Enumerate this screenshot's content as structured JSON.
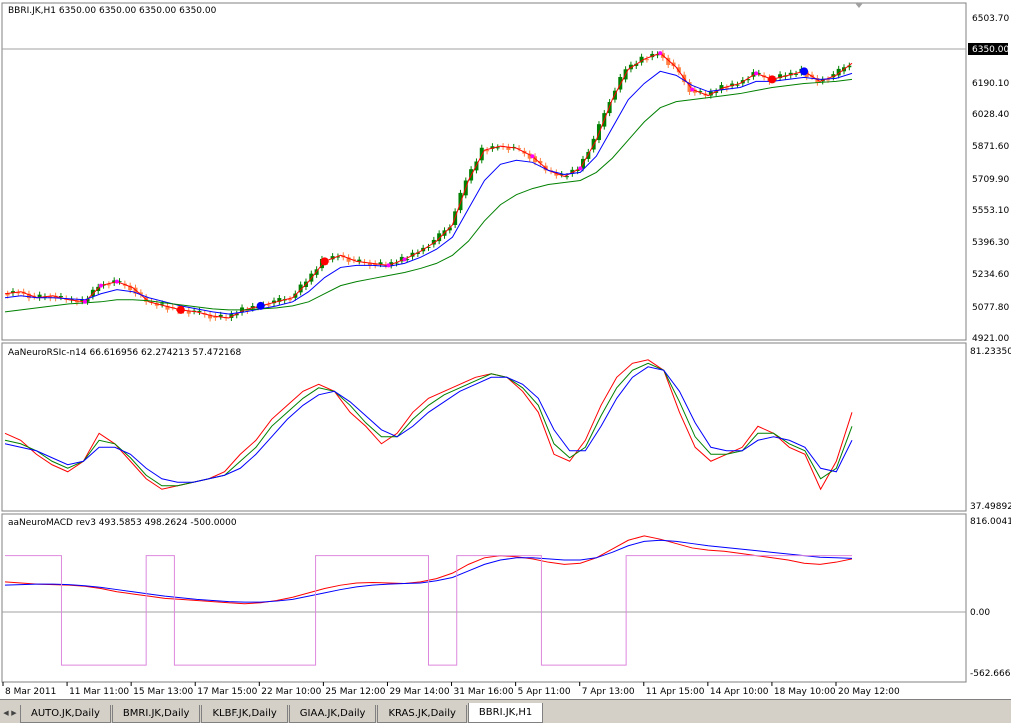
{
  "main_pane": {
    "title": "BBRI.JK,H1  6350.00 6350.00 6350.00 6350.00",
    "price_ticks": [
      "6503.70",
      "6350.00",
      "6190.10",
      "6028.40",
      "5871.60",
      "5709.90",
      "5553.10",
      "5396.30",
      "5234.60",
      "5077.80",
      "4921.00"
    ],
    "current_price_label": "6350.00"
  },
  "rsi_pane": {
    "title": "AaNeuroRSIc-n14 66.616956 62.274213 57.472168",
    "ticks": [
      "81.23350",
      "37.49892"
    ]
  },
  "macd_pane": {
    "title": "aaNeuroMACD rev3 493.5853 498.2624 -500.0000",
    "ticks": [
      "816.0041",
      "0.00",
      "-562.666"
    ]
  },
  "time_axis": {
    "labels": [
      "8 Mar 2011",
      "11 Mar 11:00",
      "15 Mar 13:00",
      "17 Mar 15:00",
      "22 Mar 10:00",
      "25 Mar 12:00",
      "29 Mar 14:00",
      "31 Mar 16:00",
      "5 Apr 11:00",
      "7 Apr 13:00",
      "11 Apr 15:00",
      "14 Apr 10:00",
      "18 May 10:00",
      "20 May 12:00"
    ]
  },
  "tabs": [
    {
      "label": "AUTO.JK,Daily",
      "active": false
    },
    {
      "label": "BMRI.JK,Daily",
      "active": false
    },
    {
      "label": "KLBF.JK,Daily",
      "active": false
    },
    {
      "label": "GIAA.JK,Daily",
      "active": false
    },
    {
      "label": "KRAS.JK,Daily",
      "active": false
    },
    {
      "label": "BBRI.JK,H1",
      "active": true
    }
  ],
  "colors": {
    "bull_candle": "#008000",
    "bear_candle": "#ff8040",
    "ma_fast": "#ff0000",
    "ma_mid": "#0000ff",
    "ma_slow": "#008000",
    "signal_dot": "#ff00ff",
    "rsi_lines": [
      "#ff0000",
      "#008000",
      "#0000ff"
    ],
    "macd_lines": [
      "#ff0000",
      "#0000ff",
      "#dd88dd"
    ]
  },
  "chart_data": [
    {
      "type": "line",
      "description_source": "candlestick price pane with three moving averages",
      "ylim": [
        4921.0,
        6503.7
      ],
      "series": [
        {
          "values": [
            5140,
            5150,
            5120,
            5130,
            5110,
            5100,
            5180,
            5200,
            5170,
            5100,
            5080,
            5060,
            5050,
            5030,
            5020,
            5060,
            5080,
            5100,
            5120,
            5200,
            5300,
            5330,
            5300,
            5290,
            5280,
            5310,
            5350,
            5400,
            5480,
            5700,
            5850,
            5870,
            5860,
            5820,
            5750,
            5720,
            5760,
            5900,
            6100,
            6250,
            6300,
            6330,
            6260,
            6150,
            6120,
            6160,
            6180,
            6230,
            6200,
            6220,
            6240,
            6190,
            6220,
            6280
          ]
        },
        {
          "values": [
            5120,
            5130,
            5120,
            5120,
            5115,
            5110,
            5140,
            5160,
            5150,
            5120,
            5100,
            5080,
            5065,
            5050,
            5040,
            5050,
            5065,
            5080,
            5100,
            5150,
            5220,
            5270,
            5280,
            5280,
            5275,
            5290,
            5320,
            5360,
            5420,
            5560,
            5700,
            5780,
            5800,
            5790,
            5750,
            5730,
            5740,
            5820,
            5960,
            6100,
            6180,
            6240,
            6220,
            6170,
            6140,
            6150,
            6160,
            6190,
            6190,
            6200,
            6210,
            6200,
            6205,
            6230
          ]
        },
        {
          "values": [
            5050,
            5060,
            5070,
            5080,
            5090,
            5095,
            5100,
            5110,
            5110,
            5105,
            5095,
            5085,
            5075,
            5065,
            5060,
            5060,
            5065,
            5070,
            5080,
            5100,
            5140,
            5180,
            5200,
            5215,
            5230,
            5245,
            5265,
            5290,
            5330,
            5400,
            5500,
            5580,
            5630,
            5660,
            5680,
            5690,
            5700,
            5740,
            5810,
            5900,
            5990,
            6060,
            6090,
            6100,
            6110,
            6120,
            6130,
            6145,
            6160,
            6170,
            6180,
            6185,
            6190,
            6200
          ]
        }
      ]
    },
    {
      "type": "line",
      "ylim": [
        37.49892,
        81.2335
      ],
      "series": [
        {
          "values": [
            58,
            56,
            52,
            49,
            47,
            50,
            58,
            55,
            50,
            45,
            42,
            43,
            44,
            45,
            47,
            52,
            56,
            62,
            66,
            70,
            72,
            70,
            64,
            60,
            55,
            58,
            64,
            68,
            70,
            72,
            74,
            75,
            74,
            70,
            64,
            52,
            50,
            56,
            66,
            74,
            78,
            79,
            76,
            64,
            54,
            50,
            52,
            54,
            60,
            58,
            54,
            52,
            42,
            50,
            64
          ]
        },
        {
          "values": [
            56,
            55,
            53,
            50,
            48,
            50,
            56,
            55,
            51,
            46,
            43,
            43,
            44,
            45,
            46,
            50,
            54,
            60,
            64,
            68,
            71,
            70,
            66,
            61,
            57,
            57,
            62,
            66,
            69,
            71,
            73,
            75,
            74,
            71,
            66,
            55,
            51,
            54,
            63,
            71,
            76,
            78,
            76,
            67,
            57,
            52,
            52,
            53,
            58,
            58,
            55,
            53,
            45,
            48,
            60
          ]
        },
        {
          "values": [
            55,
            54,
            53,
            51,
            49,
            50,
            54,
            54,
            52,
            48,
            45,
            44,
            44,
            45,
            46,
            48,
            52,
            57,
            62,
            66,
            69,
            70,
            67,
            63,
            59,
            57,
            60,
            64,
            67,
            70,
            72,
            74,
            74,
            72,
            68,
            59,
            53,
            53,
            60,
            68,
            74,
            77,
            76,
            70,
            61,
            54,
            53,
            53,
            56,
            57,
            56,
            54,
            48,
            47,
            56
          ]
        }
      ]
    },
    {
      "type": "line",
      "ylim": [
        -562.666,
        816.0041
      ],
      "series": [
        {
          "values": [
            260,
            250,
            240,
            235,
            230,
            220,
            200,
            170,
            150,
            130,
            110,
            100,
            90,
            80,
            70,
            60,
            70,
            90,
            120,
            160,
            200,
            230,
            250,
            255,
            250,
            245,
            260,
            290,
            340,
            420,
            480,
            500,
            490,
            470,
            440,
            420,
            430,
            480,
            560,
            640,
            680,
            650,
            610,
            570,
            550,
            540,
            520,
            500,
            480,
            460,
            430,
            420,
            440,
            470
          ]
        },
        {
          "values": [
            230,
            235,
            240,
            240,
            235,
            225,
            210,
            190,
            170,
            150,
            130,
            115,
            100,
            90,
            80,
            75,
            75,
            85,
            100,
            130,
            160,
            190,
            215,
            230,
            240,
            245,
            250,
            270,
            300,
            360,
            420,
            460,
            480,
            480,
            470,
            460,
            460,
            480,
            530,
            590,
            630,
            640,
            630,
            610,
            590,
            575,
            560,
            545,
            530,
            515,
            500,
            485,
            480,
            475
          ]
        },
        {
          "values": [
            500,
            500,
            -500,
            -500,
            -500,
            500,
            -500,
            -500,
            -500,
            -500,
            -500,
            500,
            500,
            500,
            500,
            -500,
            500,
            500,
            500,
            -500,
            -500,
            -500,
            500,
            500,
            500,
            500,
            500,
            500,
            500,
            500
          ]
        }
      ]
    }
  ]
}
